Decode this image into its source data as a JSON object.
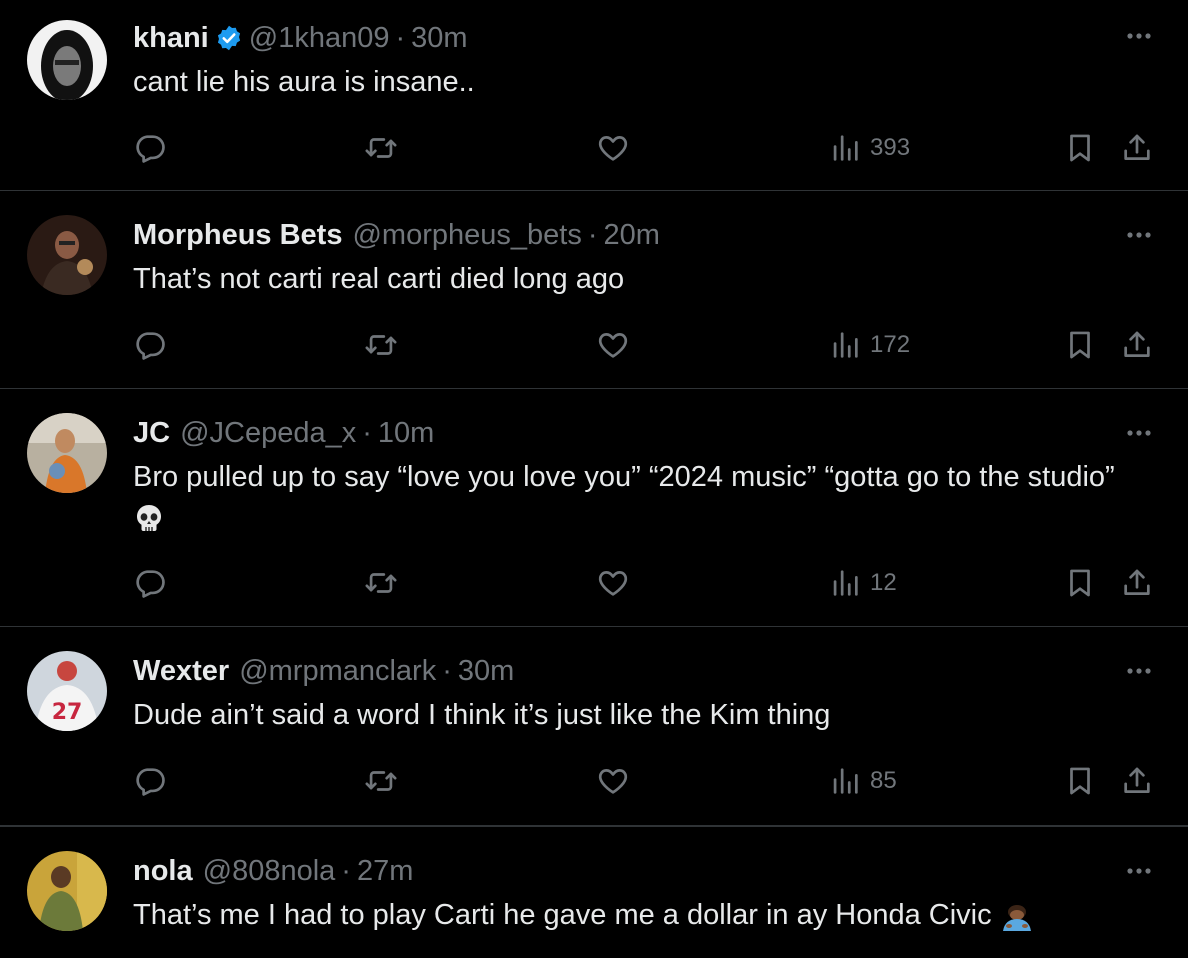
{
  "colors": {
    "background": "#000000",
    "text": "#e7e9ea",
    "muted": "#71767b",
    "divider": "#2f3336",
    "verified": "#1d9bf0"
  },
  "tweets": [
    {
      "name": "khani",
      "verified": true,
      "handle": "@1khan09",
      "time": "30m",
      "text": "cant lie his aura is insane..",
      "views": "393",
      "avatar_icon": "avatar-khani"
    },
    {
      "name": "Morpheus Bets",
      "verified": false,
      "handle": "@morpheus_bets",
      "time": "20m",
      "text": "That’s not carti real carti died long ago",
      "views": "172",
      "avatar_icon": "avatar-morpheus"
    },
    {
      "name": "JC",
      "verified": false,
      "handle": "@JCepeda_x",
      "time": "10m",
      "text": "Bro pulled up to say “love you love you” “2024 music” “gotta go to the studio”",
      "text_emoji": "skull-emoji",
      "views": "12",
      "avatar_icon": "avatar-jc"
    },
    {
      "name": "Wexter",
      "verified": false,
      "handle": "@mrpmanclark",
      "time": "30m",
      "text": "Dude ain’t said a word I think it’s just like the Kim thing",
      "views": "85",
      "avatar_icon": "avatar-wexter"
    },
    {
      "name": "nola",
      "verified": false,
      "handle": "@808nola",
      "time": "27m",
      "text": "That’s me I had to play Carti he gave me a dollar in ay Honda Civic",
      "text_emoji": "person-bowing-emoji",
      "avatar_icon": "avatar-nola"
    }
  ],
  "separator": "·"
}
